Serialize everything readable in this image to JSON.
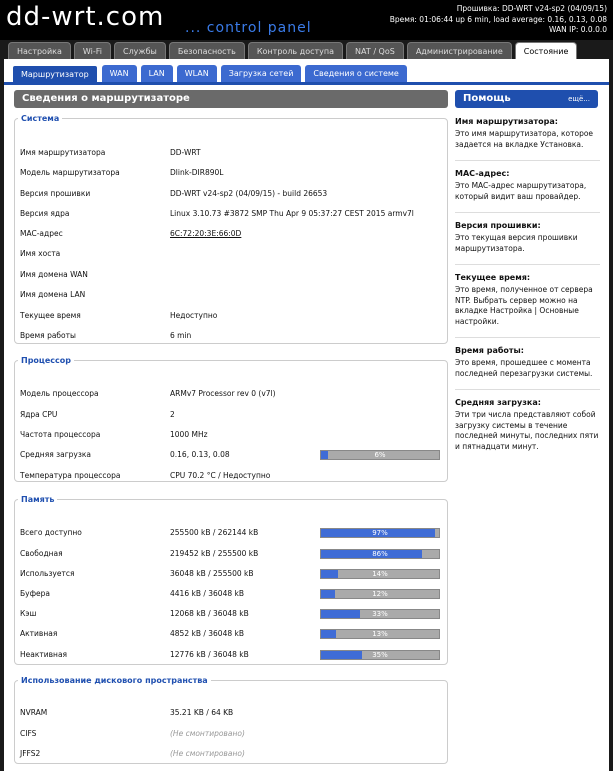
{
  "header": {
    "logo": "dd-wrt.com",
    "logo_sub": "... control panel",
    "firmware": "Прошивка: DD-WRT v24-sp2 (04/09/15)",
    "time": "Время: 01:06:44 up 6 min, load average: 0.16, 0.13, 0.08",
    "wan_ip": "WAN IP: 0.0.0.0"
  },
  "main_tabs": [
    "Настройка",
    "Wi-Fi",
    "Службы",
    "Безопасность",
    "Контроль доступа",
    "NAT / QoS",
    "Администрирование",
    "Состояние"
  ],
  "sub_tabs": [
    "Маршрутизатор",
    "WAN",
    "LAN",
    "WLAN",
    "Загрузка сетей",
    "Сведения о системе"
  ],
  "page_title": "Сведения о маршрутизаторе",
  "system": {
    "legend": "Система",
    "rows": [
      {
        "label": "Имя маршрутизатора",
        "value": "DD-WRT"
      },
      {
        "label": "Модель маршрутизатора",
        "value": "Dlink-DIR890L"
      },
      {
        "label": "Версия прошивки",
        "value": "DD-WRT v24-sp2 (04/09/15) - build 26653"
      },
      {
        "label": "Версия ядра",
        "value": "Linux 3.10.73 #3872 SMP Thu Apr 9 05:37:27 CEST 2015 armv7l"
      },
      {
        "label": "MAC-адрес",
        "value": "6C:72:20:3E:66:0D"
      },
      {
        "label": "Имя хоста",
        "value": ""
      },
      {
        "label": "Имя домена WAN",
        "value": ""
      },
      {
        "label": "Имя домена LAN",
        "value": ""
      },
      {
        "label": "Текущее время",
        "value": "Недоступно"
      },
      {
        "label": "Время работы",
        "value": "6 min"
      }
    ]
  },
  "cpu": {
    "legend": "Процессор",
    "rows": [
      {
        "label": "Модель процессора",
        "value": "ARMv7 Processor rev 0 (v7l)"
      },
      {
        "label": "Ядра CPU",
        "value": "2"
      },
      {
        "label": "Частота процессора",
        "value": "1000 MHz"
      },
      {
        "label": "Средняя загрузка",
        "value": "0.16, 0.13, 0.08",
        "bar": "6%",
        "pct": 6
      },
      {
        "label": "Температура процессора",
        "value": "CPU 70.2 °C / Недоступно"
      }
    ]
  },
  "memory": {
    "legend": "Память",
    "rows": [
      {
        "label": "Всего доступно",
        "value": "255500 kB / 262144 kB",
        "bar": "97%",
        "pct": 97
      },
      {
        "label": "Свободная",
        "value": "219452 kB / 255500 kB",
        "bar": "86%",
        "pct": 86
      },
      {
        "label": "Используется",
        "value": "36048 kB / 255500 kB",
        "bar": "14%",
        "pct": 14
      },
      {
        "label": "Буфера",
        "value": "4416 kB / 36048 kB",
        "bar": "12%",
        "pct": 12
      },
      {
        "label": "Кэш",
        "value": "12068 kB / 36048 kB",
        "bar": "33%",
        "pct": 33
      },
      {
        "label": "Активная",
        "value": "4852 kB / 36048 kB",
        "bar": "13%",
        "pct": 13
      },
      {
        "label": "Неактивная",
        "value": "12776 kB / 36048 kB",
        "bar": "35%",
        "pct": 35
      }
    ]
  },
  "disk": {
    "legend": "Использование дискового пространства",
    "rows": [
      {
        "label": "NVRAM",
        "value": "35.21 KB / 64 KB"
      },
      {
        "label": "CIFS",
        "value": "(Не смонтировано)"
      },
      {
        "label": "JFFS2",
        "value": "(Не смонтировано)"
      }
    ]
  },
  "help": {
    "title": "Помощь",
    "more": "ещё...",
    "items": [
      {
        "title": "Имя маршрутизатора:",
        "text": "Это имя маршрутизатора, которое задается на вкладке Установка."
      },
      {
        "title": "MAC-адрес:",
        "text": "Это MAC-адрес маршрутизатора, который видит ваш провайдер."
      },
      {
        "title": "Версия прошивки:",
        "text": "Это текущая версия прошивки маршрутизатора."
      },
      {
        "title": "Текущее время:",
        "text": "Это время, полученное от сервера NTP. Выбрать сервер можно на вкладке Настройка | Основные настройки."
      },
      {
        "title": "Время работы:",
        "text": "Это время, прошедшее с момента последней перезагрузки системы."
      },
      {
        "title": "Средняя загрузка:",
        "text": "Эти три числа представляют собой загрузку системы в течение последней минуты, последних пяти и пятнадцати минут."
      }
    ]
  },
  "colors": {
    "accent": "#1f4fae",
    "bar_fill": "#3f6cd6",
    "bar_bg": "#aaaaaa"
  }
}
